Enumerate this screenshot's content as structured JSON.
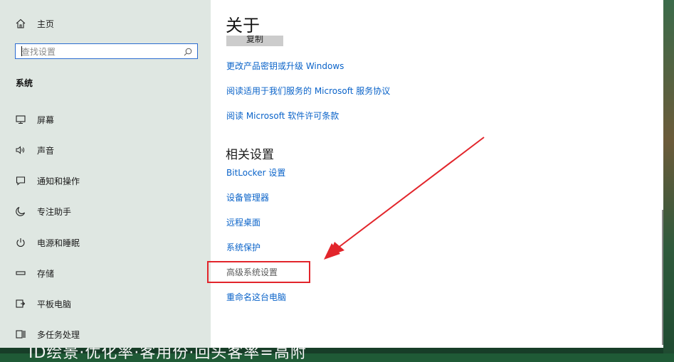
{
  "sidebar": {
    "home": "主页",
    "search": {
      "placeholder": "查找设置"
    },
    "section": "系统",
    "items": [
      {
        "label": "屏幕",
        "icon": "monitor-icon"
      },
      {
        "label": "声音",
        "icon": "speaker-icon"
      },
      {
        "label": "通知和操作",
        "icon": "notification-icon"
      },
      {
        "label": "专注助手",
        "icon": "moon-icon"
      },
      {
        "label": "电源和睡眠",
        "icon": "power-icon"
      },
      {
        "label": "存储",
        "icon": "storage-icon"
      },
      {
        "label": "平板电脑",
        "icon": "tablet-icon"
      },
      {
        "label": "多任务处理",
        "icon": "multitask-icon"
      }
    ]
  },
  "main": {
    "title": "关于",
    "copy_button": "复制",
    "links": [
      "更改产品密钥或升级 Windows",
      "阅读适用于我们服务的 Microsoft 服务协议",
      "阅读 Microsoft 软件许可条款"
    ],
    "related_title": "相关设置",
    "related_links": [
      "BitLocker 设置",
      "设备管理器",
      "远程桌面",
      "系统保护",
      "高级系统设置",
      "重命名这台电脑"
    ]
  },
  "desktop": {
    "caption": "ID绘景·优化率·客用份·回头客率=高附"
  },
  "colors": {
    "link": "#0a63c9",
    "accent": "#2b6cd1",
    "highlight": "#e2252b",
    "sidebar_bg": "#dfe7e2"
  }
}
